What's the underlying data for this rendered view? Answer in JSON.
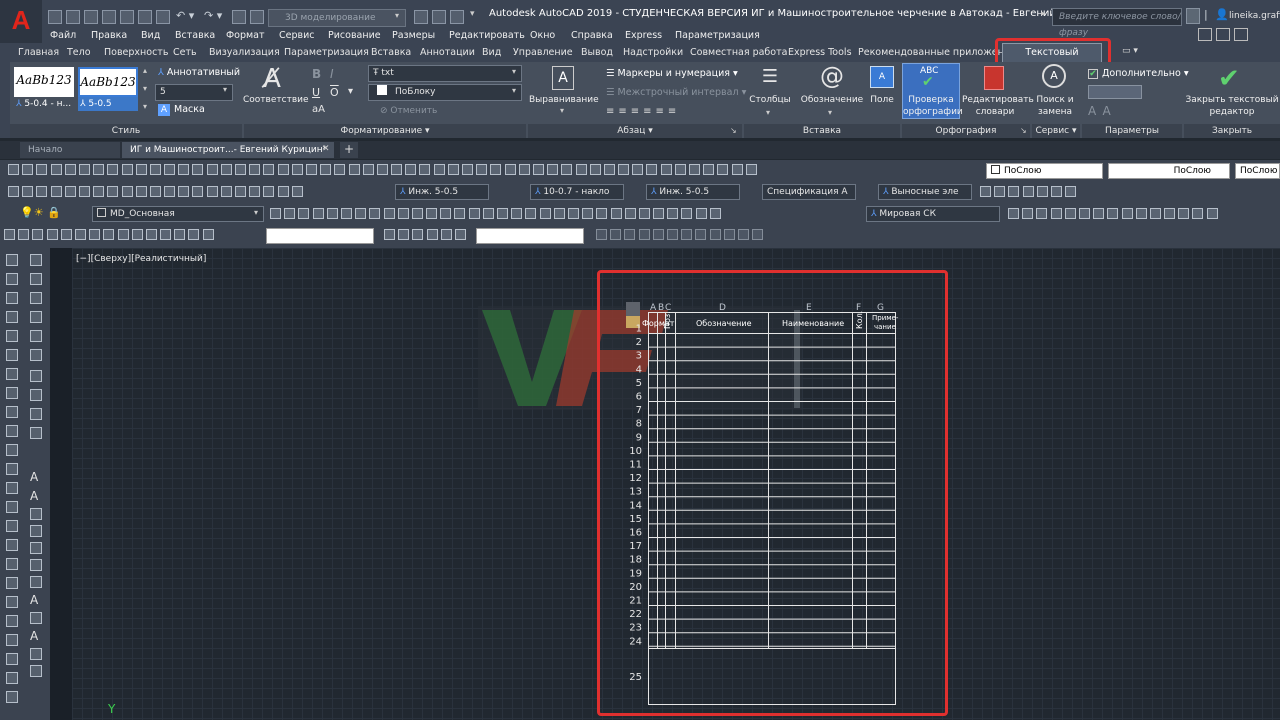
{
  "titlebar": {
    "logo": "A",
    "workspace": "3D моделирование",
    "title": "Autodesk AutoCAD 2019 - СТУДЕНЧЕСКАЯ ВЕРСИЯ    ИГ и Машиностроительное черчение в Автокад - Евгений Курицин.dwg",
    "search_placeholder": "Введите ключевое слово/фразу",
    "user": "lineika.grafit"
  },
  "menubar": [
    "Файл",
    "Правка",
    "Вид",
    "Вставка",
    "Формат",
    "Сервис",
    "Рисование",
    "Размеры",
    "Редактировать",
    "Окно",
    "Справка",
    "Express",
    "Параметризация"
  ],
  "ribbon_tabs": [
    "Главная",
    "Тело",
    "Поверхность",
    "Сеть",
    "Визуализация",
    "Параметризация",
    "Вставка",
    "Аннотации",
    "Вид",
    "Управление",
    "Вывод",
    "Надстройки",
    "Совместная работа",
    "Express Tools",
    "Рекомендованные приложения"
  ],
  "ribbon_active_tab": "Текстовый редактор",
  "ribbon": {
    "style": {
      "swatch1": "AaBb123",
      "swatch2": "AaBb123",
      "swatch1_label": "5-0.4 - н...",
      "swatch2_label": "5-0.5",
      "annotative": "Аннотативный",
      "height": "5",
      "mask": "Маска",
      "title": "Стиль"
    },
    "formatting": {
      "match": "Соответствие",
      "font": "txt",
      "color": "ПоБлоку",
      "undo": "Отменить",
      "title": "Форматирование ▾"
    },
    "paragraph": {
      "align": "Выравнивание",
      "bullets": "Маркеры и нумерация",
      "line_spacing": "Межстрочный интервал",
      "title": "Абзац ▾"
    },
    "insert": {
      "columns": "Столбцы",
      "symbol": "Обозначение",
      "field": "Поле",
      "title": "Вставка"
    },
    "spelling": {
      "check": "Проверка орфографии",
      "abc": "ABC",
      "dict": "Редактировать словари",
      "title": "Орфография"
    },
    "tools": {
      "find": "Поиск и замена",
      "title": "Сервис ▾"
    },
    "options": {
      "more": "Дополнительно",
      "title": "Параметры"
    },
    "close": {
      "label": "Закрыть текстовый редактор",
      "title": "Закрыть"
    }
  },
  "doc_tabs": [
    "Начало",
    "ИГ и Машиностроит...- Евгений Курицин*"
  ],
  "toolbars": {
    "layer_color": "ПоСлою",
    "linetype": "ПоСлою",
    "lineweight": "ПоСлою",
    "dimstyle": "Инж. 5-0.5",
    "textstyle": "10-0.7 - накло",
    "tablestyle": "Инж. 5-0.5",
    "spec": "Спецификация А",
    "leader": "Выносные эле",
    "layer": "MD_Основная",
    "ucs": "Мировая СК"
  },
  "viewport_label": "[−][Сверху][Реалистичный]",
  "table": {
    "col_letters": [
      "A",
      "B",
      "C",
      "D",
      "E",
      "F",
      "G"
    ],
    "headers": {
      "format": "Формат",
      "zone": "Поз.",
      "designation": "Обозначение",
      "name": "Наименование",
      "qty": "Кол.",
      "note": "Приме-\nчание"
    },
    "row_numbers": [
      "1",
      "2",
      "3",
      "4",
      "5",
      "6",
      "7",
      "8",
      "9",
      "10",
      "11",
      "12",
      "13",
      "14",
      "15",
      "16",
      "17",
      "18",
      "19",
      "20",
      "21",
      "22",
      "23",
      "24",
      "25"
    ]
  },
  "colors": {
    "accent_red": "#e0302f",
    "background": "#212830",
    "ribbon": "#464f5c"
  }
}
